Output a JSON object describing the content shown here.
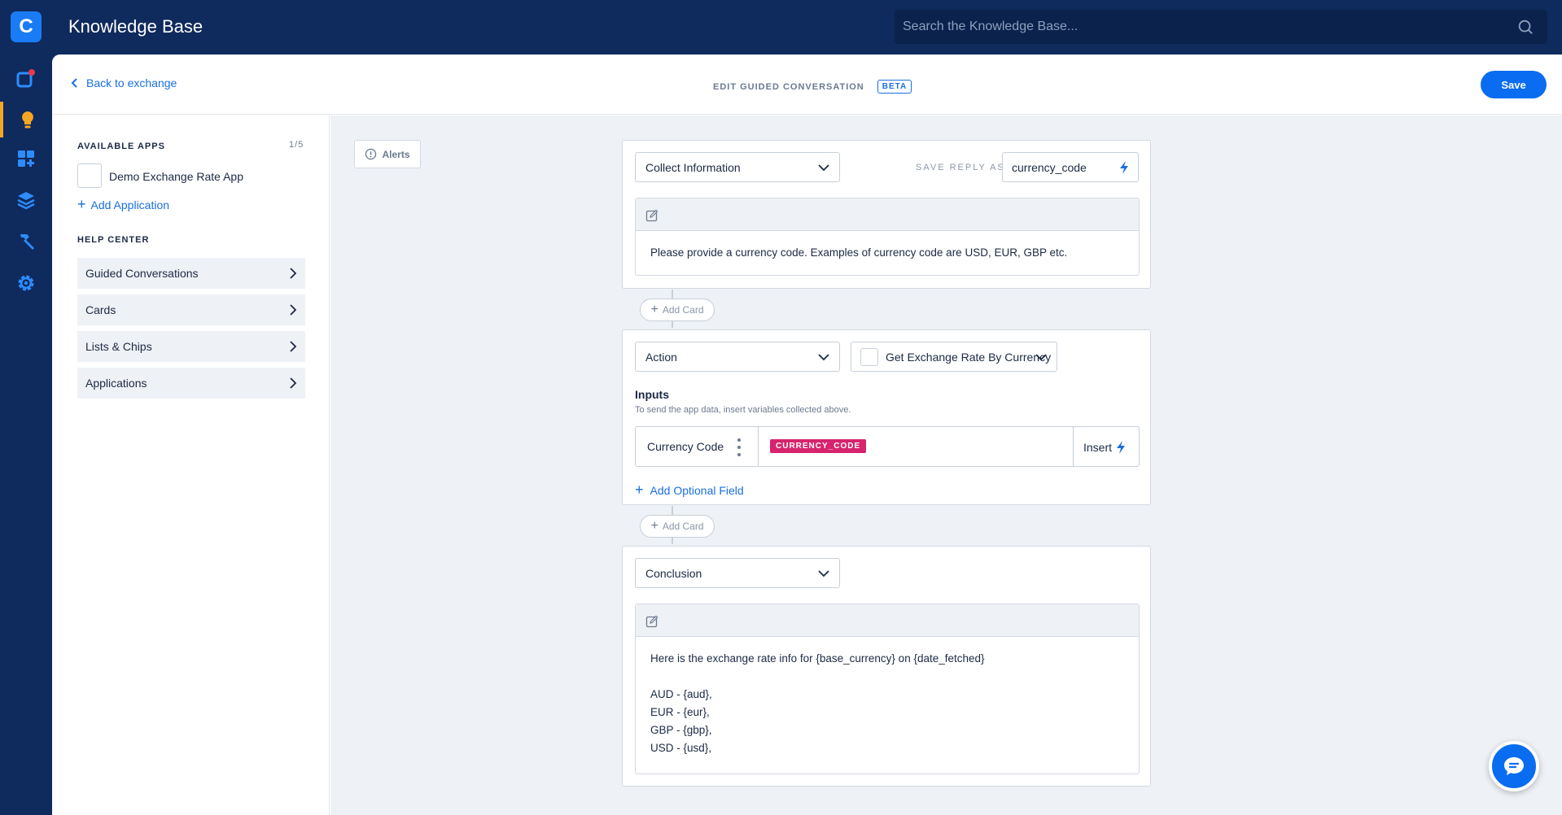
{
  "app": {
    "logo_letter": "C",
    "title": "Knowledge Base"
  },
  "search": {
    "placeholder": "Search the Knowledge Base..."
  },
  "nav": {
    "items": [
      "apps-icon",
      "lightbulb-icon",
      "grid-icon",
      "layers-icon",
      "hammer-icon",
      "gear-icon"
    ],
    "active_index": 1
  },
  "header": {
    "back_label": "Back to exchange",
    "edit_title": "EDIT GUIDED CONVERSATION",
    "beta_badge": "BETA",
    "save_label": "Save"
  },
  "sidebar": {
    "available_apps_title": "AVAILABLE APPS",
    "available_apps_count": "1/5",
    "apps": [
      {
        "name": "Demo Exchange Rate App"
      }
    ],
    "add_application_label": "Add Application",
    "help_center_title": "HELP CENTER",
    "help_items": [
      {
        "label": "Guided Conversations"
      },
      {
        "label": "Cards"
      },
      {
        "label": "Lists & Chips"
      },
      {
        "label": "Applications"
      }
    ]
  },
  "canvas": {
    "alerts_label": "Alerts",
    "add_card_label": "Add Card",
    "cards": [
      {
        "type_label": "Collect Information",
        "save_reply_label": "SAVE REPLY AS",
        "save_reply_value": "currency_code",
        "body": "Please provide a currency code. Examples of currency code are USD, EUR, GBP etc."
      },
      {
        "type_label": "Action",
        "app_action": "Get Exchange Rate By Currency",
        "inputs_title": "Inputs",
        "inputs_subtitle": "To send the app data, insert variables collected above.",
        "input_label": "Currency Code",
        "input_variable": "CURRENCY_CODE",
        "insert_label": "Insert",
        "add_optional_label": "Add Optional Field"
      },
      {
        "type_label": "Conclusion",
        "body": "Here is the exchange rate info for {base_currency} on {date_fetched}\n\nAUD - {aud},\nEUR - {eur},\nGBP - {gbp},\nUSD - {usd},"
      }
    ]
  },
  "colors": {
    "nav_bg": "#0f2a5c",
    "accent": "#0a6cf0",
    "active_nav": "#f5a623",
    "variable_chip": "#d6246e"
  }
}
